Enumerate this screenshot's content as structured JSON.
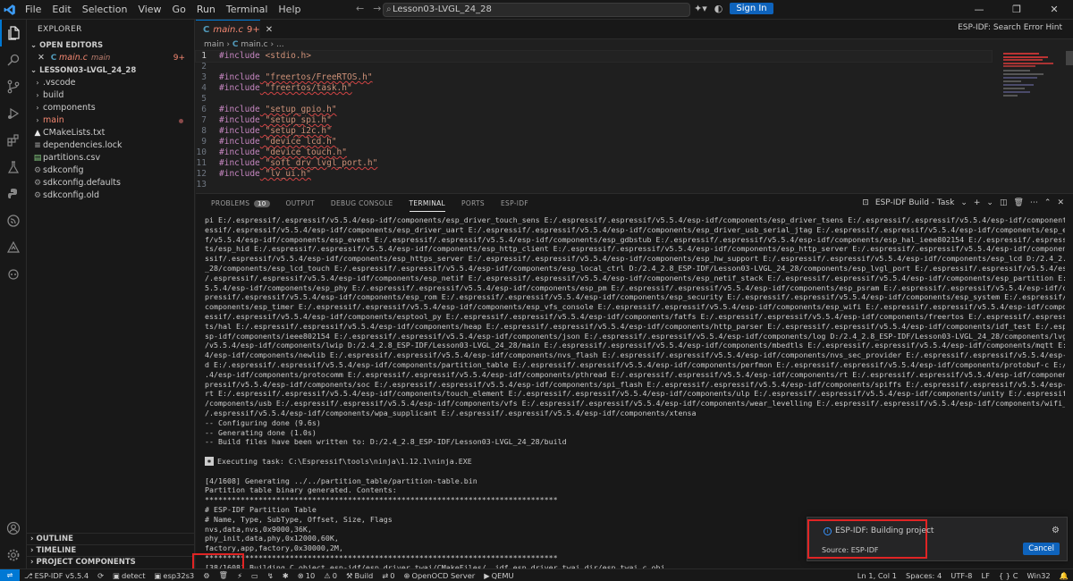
{
  "titlebar": {
    "menu": [
      "File",
      "Edit",
      "Selection",
      "View",
      "Go",
      "Run",
      "Terminal",
      "Help"
    ],
    "search_text": "Lesson03-LVGL_24_28",
    "signin_label": "Sign In",
    "window_buttons": [
      "—",
      "❐",
      "✕"
    ]
  },
  "sidebar": {
    "title": "EXPLORER",
    "open_editors_label": "OPEN EDITORS",
    "open_editor": {
      "file": "main.c",
      "folder": "main",
      "badge": "9+"
    },
    "project_label": "LESSON03-LVGL_24_28",
    "tree": [
      {
        "name": ".vscode",
        "type": "folder"
      },
      {
        "name": "build",
        "type": "folder"
      },
      {
        "name": "components",
        "type": "folder"
      },
      {
        "name": "main",
        "type": "folder-error"
      },
      {
        "name": "CMakeLists.txt",
        "type": "cmake"
      },
      {
        "name": "dependencies.lock",
        "type": "file"
      },
      {
        "name": "partitions.csv",
        "type": "csv"
      },
      {
        "name": "sdkconfig",
        "type": "gear"
      },
      {
        "name": "sdkconfig.defaults",
        "type": "gear"
      },
      {
        "name": "sdkconfig.old",
        "type": "gear"
      }
    ],
    "bottom_sections": [
      "OUTLINE",
      "TIMELINE",
      "PROJECT COMPONENTS"
    ]
  },
  "editor": {
    "tab": {
      "name": "main.c",
      "badge": "9+"
    },
    "hint": "ESP-IDF: Search Error Hint",
    "breadcrumb": {
      "folder": "main",
      "file": "main.c",
      "tail": "..."
    },
    "lines": [
      {
        "n": "1",
        "kw": "#include",
        "str": " <stdio.h>"
      },
      {
        "n": "2",
        "kw": "",
        "str": ""
      },
      {
        "n": "3",
        "kw": "#include",
        "str": " \"freertos/FreeRTOS.h\""
      },
      {
        "n": "4",
        "kw": "#include",
        "str": " \"freertos/task.h\""
      },
      {
        "n": "5",
        "kw": "",
        "str": ""
      },
      {
        "n": "6",
        "kw": "#include",
        "str": " \"setup_gpio.h\""
      },
      {
        "n": "7",
        "kw": "#include",
        "str": " \"setup_spi.h\""
      },
      {
        "n": "8",
        "kw": "#include",
        "str": " \"setup_i2c.h\""
      },
      {
        "n": "9",
        "kw": "#include",
        "str": " \"device_lcd.h\""
      },
      {
        "n": "10",
        "kw": "#include",
        "str": " \"device_touch.h\""
      },
      {
        "n": "11",
        "kw": "#include",
        "str": " \"soft_drv_lvgl_port.h\""
      },
      {
        "n": "12",
        "kw": "#include",
        "str": " \"lv_ui.h\""
      },
      {
        "n": "13",
        "kw": "",
        "str": ""
      }
    ]
  },
  "panel": {
    "tabs": [
      {
        "label": "PROBLEMS",
        "count": "10"
      },
      {
        "label": "OUTPUT"
      },
      {
        "label": "DEBUG CONSOLE"
      },
      {
        "label": "TERMINAL",
        "active": true
      },
      {
        "label": "PORTS"
      },
      {
        "label": "ESP-IDF"
      }
    ],
    "task_label": "ESP-IDF Build - Task",
    "terminal_lines": [
      "pi E:/.espressif/.espressif/v5.5.4/esp-idf/components/esp_driver_touch_sens E:/.espressif/.espressif/v5.5.4/esp-idf/components/esp_driver_tsens E:/.espressif/.espressif/v5.5.4/esp-idf/components/esp_driver_twai E:/.espr",
      "essif/.espressif/v5.5.4/esp-idf/components/esp_driver_uart E:/.espressif/.espressif/v5.5.4/esp-idf/components/esp_driver_usb_serial_jtag E:/.espressif/.espressif/v5.5.4/esp-idf/components/esp_eth E:/.espressi",
      "f/v5.5.4/esp-idf/components/esp_event E:/.espressif/.espressif/v5.5.4/esp-idf/components/esp_gdbstub E:/.espressif/.espressif/v5.5.4/esp-idf/components/esp_hal_ieee802154 E:/.espressif/.espressif/v5.5.4/esp-idf/componen",
      "ts/esp_hid E:/.espressif/.espressif/v5.5.4/esp-idf/components/esp_http_client E:/.espressif/.espressif/v5.5.4/esp-idf/components/esp_http_server E:/.espressif/.espressif/v5.5.4/esp-idf/components/esp_https_ota E:/.espre",
      "ssif/.espressif/v5.5.4/esp-idf/components/esp_https_server E:/.espressif/.espressif/v5.5.4/esp-idf/components/esp_hw_support E:/.espressif/.espressif/v5.5.4/esp-idf/components/esp_lcd D:/2.4_2.8_ESP-IDF/Lesson03-LVGL_24",
      "_28/components/esp_lcd_touch E:/.espressif/.espressif/v5.5.4/esp-idf/components/esp_local_ctrl D:/2.4_2.8_ESP-IDF/Lesson03-LVGL_24_28/components/esp_lvgl_port E:/.espressif/.espressif/v5.5.4/esp-idf/components/esp_mm E:",
      "/.espressif/.espressif/v5.5.4/esp-idf/components/esp_netif E:/.espressif/.espressif/v5.5.4/esp-idf/components/esp_netif_stack E:/.espressif/.espressif/v5.5.4/esp-idf/components/esp_partition E:/.espressif/.espressif/v",
      "5.5.4/esp-idf/components/esp_phy E:/.espressif/.espressif/v5.5.4/esp-idf/components/esp_pm E:/.espressif/.espressif/v5.5.4/esp-idf/components/esp_psram E:/.espressif/.espressif/v5.5.4/esp-idf/components/esp_ringbuf E:/.es",
      "pressif/.espressif/v5.5.4/esp-idf/components/esp_rom E:/.espressif/.espressif/v5.5.4/esp-idf/components/esp_security E:/.espressif/.espressif/v5.5.4/esp-idf/components/esp_system E:/.espressif/.espressif/v5.5.4/esp-idf/",
      "components/esp_timer E:/.espressif/.espressif/v5.5.4/esp-idf/components/esp_vfs_console E:/.espressif/.espressif/v5.5.4/esp-idf/components/esp_wifi E:/.espressif/.espressif/v5.5.4/esp-idf/components/espcoredump E:/.espr",
      "essif/.espressif/v5.5.4/esp-idf/components/esptool_py E:/.espressif/.espressif/v5.5.4/esp-idf/components/fatfs E:/.espressif/.espressif/v5.5.4/esp-idf/components/freertos E:/.espressif/.espressif/v5.5.4/esp-idf/componen",
      "ts/hal E:/.espressif/.espressif/v5.5.4/esp-idf/components/heap E:/.espressif/.espressif/v5.5.4/esp-idf/components/http_parser E:/.espressif/.espressif/v5.5.4/esp-idf/components/idf_test E:/.espressif/.espressif/v5.5.4/e",
      "sp-idf/components/ieee802154 E:/.espressif/.espressif/v5.5.4/esp-idf/components/json E:/.espressif/.espressif/v5.5.4/esp-idf/components/log D:/2.4_2.8_ESP-IDF/Lesson03-LVGL_24_28/components/lvgl E:/.espressif/.espressif",
      "/v5.5.4/esp-idf/components/lwip D:/2.4_2.8_ESP-IDF/Lesson03-LVGL_24_28/main E:/.espressif/.espressif/v5.5.4/esp-idf/components/mbedtls E:/.espressif/.espressif/v5.5.4/esp-idf/components/mqtt E:/.espressif/.espressif/v5.5.",
      "4/esp-idf/components/newlib E:/.espressif/.espressif/v5.5.4/esp-idf/components/nvs_flash E:/.espressif/.espressif/v5.5.4/esp-idf/components/nvs_sec_provider E:/.espressif/.espressif/v5.5.4/esp-idf/components/openthrea",
      "d E:/.espressif/.espressif/v5.5.4/esp-idf/components/partition_table E:/.espressif/.espressif/v5.5.4/esp-idf/components/perfmon E:/.espressif/.espressif/v5.5.4/esp-idf/components/protobuf-c E:/.espressif/.espressif/v5.5",
      ".4/esp-idf/components/protocomm E:/.espressif/.espressif/v5.5.4/esp-idf/components/pthread E:/.espressif/.espressif/v5.5.4/esp-idf/components/rt E:/.espressif/.espressif/v5.5.4/esp-idf/components/sdmmc E:/.espressif/.es",
      "pressif/v5.5.4/esp-idf/components/soc E:/.espressif/.espressif/v5.5.4/esp-idf/components/spi_flash E:/.espressif/.espressif/v5.5.4/esp-idf/components/spiffs E:/.espressif/.espressif/v5.5.4/esp-idf/components/tcp_transpo",
      "rt E:/.espressif/.espressif/v5.5.4/esp-idf/components/touch_element E:/.espressif/.espressif/v5.5.4/esp-idf/components/ulp E:/.espressif/.espressif/v5.5.4/esp-idf/components/unity E:/.espressif/.espressif/v5.5.4/esp-idf",
      "/components/usb E:/.espressif/.espressif/v5.5.4/esp-idf/components/vfs E:/.espressif/.espressif/v5.5.4/esp-idf/components/wear_levelling E:/.espressif/.espressif/v5.5.4/esp-idf/components/wifi_provisioning E:/.espressif",
      "/.espressif/v5.5.4/esp-idf/components/wpa_supplicant E:/.espressif/.espressif/v5.5.4/esp-idf/components/xtensa",
      "-- Configuring done (9.6s)",
      "-- Generating done (1.0s)",
      "-- Build files have been written to: D:/2.4_2.8_ESP-IDF/Lesson03-LVGL_24_28/build",
      ""
    ],
    "task_exec": "Executing task: C:\\Espressif\\tools\\ninja\\1.12.1\\ninja.EXE",
    "terminal_lines_2": [
      "",
      "[4/1608] Generating ../../partition_table/partition-table.bin",
      "Partition table binary generated. Contents:",
      "*******************************************************************************",
      "# ESP-IDF Partition Table",
      "# Name, Type, SubType, Offset, Size, Flags",
      "nvs,data,nvs,0x9000,36K,",
      "phy_init,data,phy,0x12000,60K,",
      "factory,app,factory,0x30000,2M,",
      "*******************************************************************************",
      "[38/1608] Building C object esp-idf/esp_driver_twai/CMakeFiles/__idf_esp_driver_twai.dir/esp_twai.c.obj"
    ]
  },
  "notification": {
    "title": "ESP-IDF: Building project",
    "source": "Source: ESP-IDF",
    "cancel_label": "Cancel"
  },
  "statusbar": {
    "left": [
      {
        "icon": "git-icon",
        "text": "ESP-IDF v5.5.4"
      },
      {
        "icon": "sync-icon",
        "text": ""
      },
      {
        "icon": "chip-icon",
        "text": "detect"
      },
      {
        "icon": "chip-icon",
        "text": "esp32s3"
      },
      {
        "icon": "gear-icon",
        "text": ""
      },
      {
        "icon": "trash-icon",
        "text": ""
      },
      {
        "icon": "flash-icon",
        "text": ""
      },
      {
        "icon": "screen-icon",
        "text": ""
      },
      {
        "icon": "bolt-icon",
        "text": ""
      },
      {
        "icon": "bug-icon",
        "text": ""
      },
      {
        "icon": "error-icon",
        "text": "10"
      },
      {
        "icon": "warning-icon",
        "text": "0"
      },
      {
        "icon": "build-icon",
        "text": "Build"
      },
      {
        "icon": "ports-icon",
        "text": "0"
      },
      {
        "icon": "openocd-icon",
        "text": "OpenOCD Server"
      },
      {
        "icon": "qemu-icon",
        "text": "QEMU"
      }
    ],
    "right": [
      "Ln 1, Col 1",
      "Spaces: 4",
      "UTF-8",
      "LF",
      "{ } C",
      "Win32"
    ],
    "colors": {
      "accent": "#0078d4",
      "error": "#f48771",
      "highlight": "#e02424"
    }
  }
}
